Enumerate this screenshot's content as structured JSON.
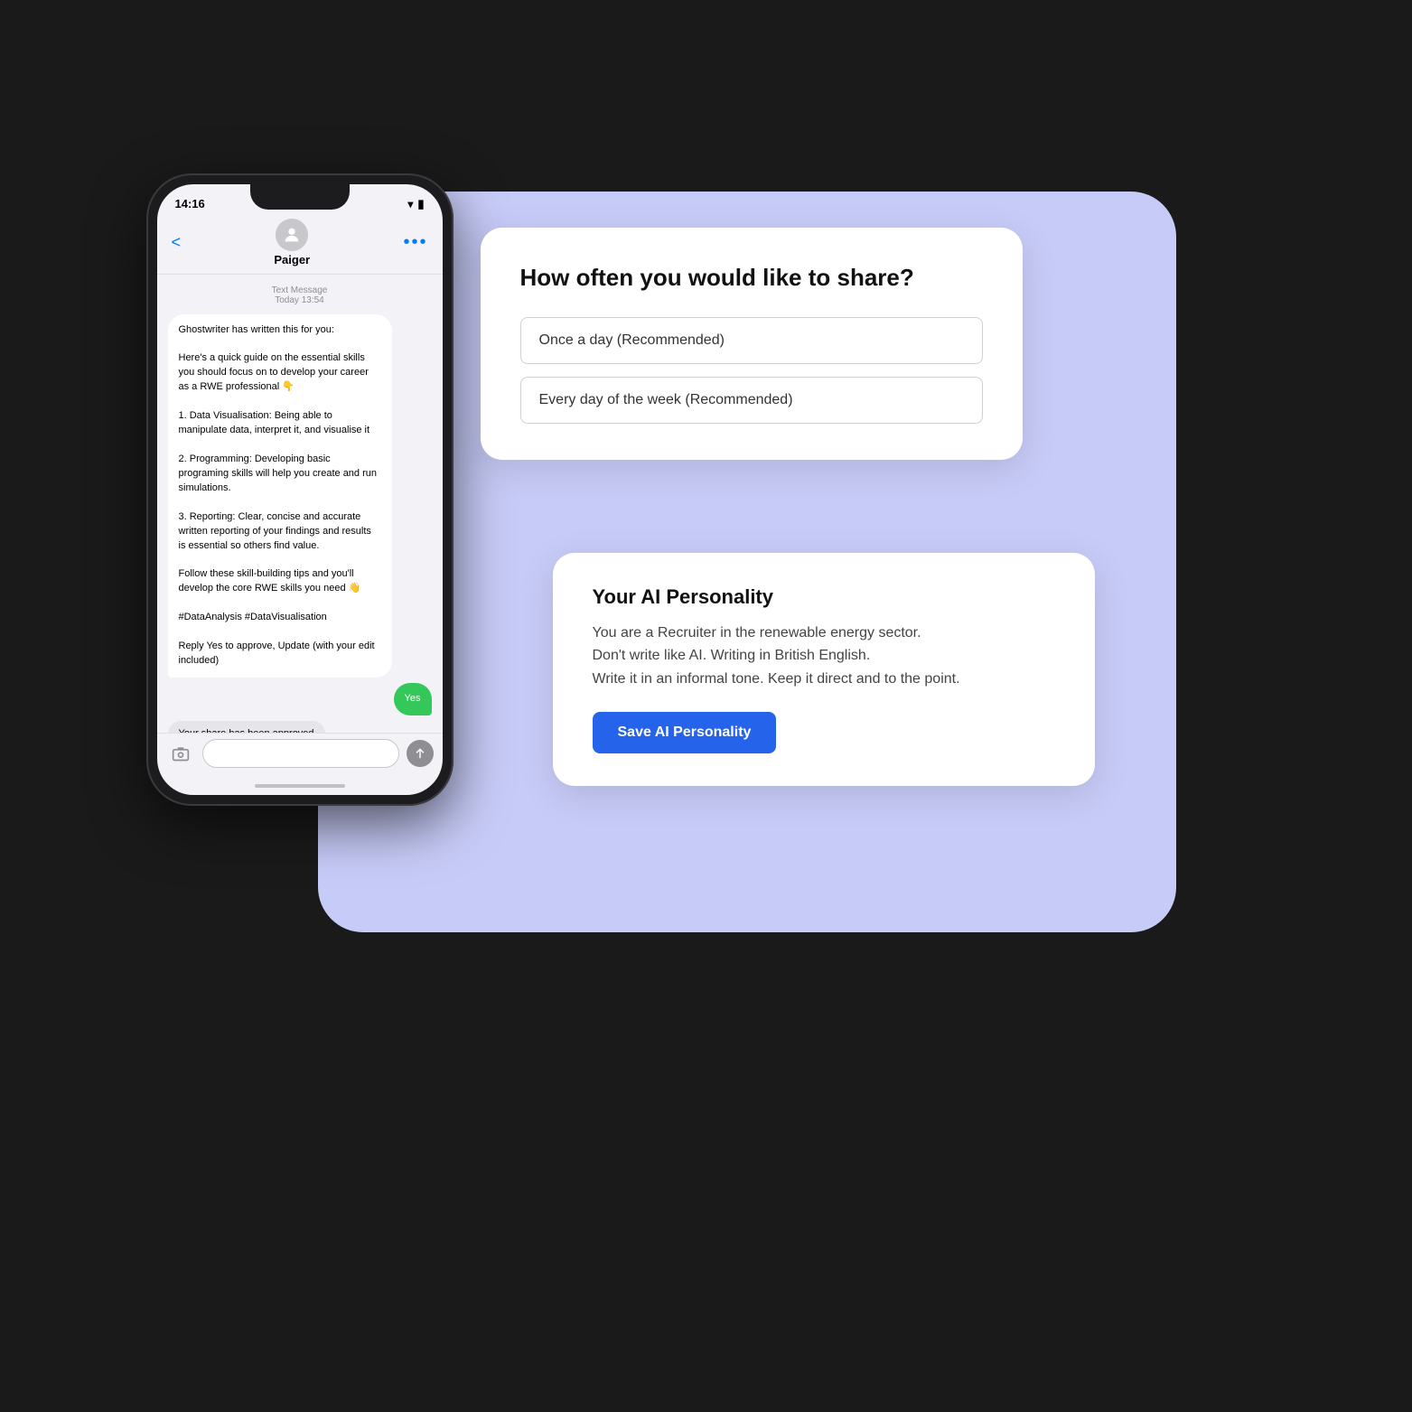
{
  "scene": {
    "background_color": "#1a1a1a"
  },
  "phone": {
    "status_time": "14:16",
    "contact_name": "Paiger",
    "message_label": "Text Message",
    "message_time": "Today 13:54",
    "back_label": "<",
    "more_label": "•••",
    "message_body": "Ghostwriter has written this for you:\n\nHere's a quick guide on the essential skills you should focus on  to develop your career as a RWE professional 👇\n\n1. Data Visualisation: Being able to manipulate data, interpret it, and visualise it\n\n2. Programming: Developing basic programing skills will help you create and run simulations.\n\n3. Reporting: Clear, concise and accurate written reporting of your findings and results is essential so others find value.\n\nFollow these skill-building tips and you'll develop the core RWE skills you need 👋\n\n#DataAnalysis #DataVisualisation\n\nReply Yes to approve, Update (with your edit included)",
    "reply_yes": "Yes",
    "approval_notification": "Your share has been approved"
  },
  "frequency_card": {
    "title": "How often you would like to share?",
    "options": [
      "Once a day (Recommended)",
      "Every day of the week (Recommended)"
    ]
  },
  "personality_card": {
    "title": "Your AI Personality",
    "description_line1": "You are a Recruiter in the renewable energy sector.",
    "description_line2": "Don't write like AI. Writing in British English.",
    "description_line3": "Write it in an informal tone. Keep it direct and to the point.",
    "save_button_label": "Save AI Personality"
  }
}
